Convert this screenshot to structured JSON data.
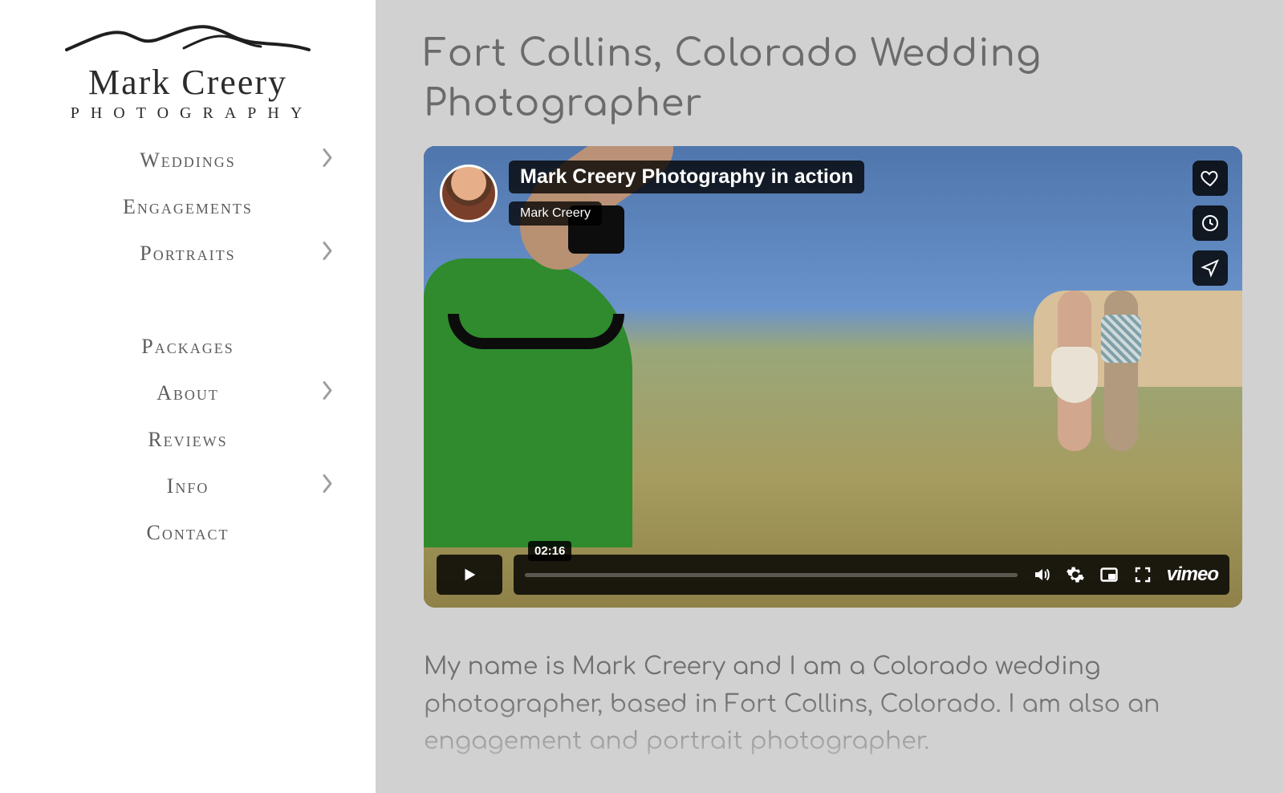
{
  "brand": {
    "line1": "Mark Creery",
    "line2": "PHOTOGRAPHY"
  },
  "nav": {
    "items": [
      {
        "label": "Weddings",
        "chevron": true
      },
      {
        "label": "Engagements",
        "chevron": false
      },
      {
        "label": "Portraits",
        "chevron": true
      }
    ],
    "items2": [
      {
        "label": "Packages",
        "chevron": false
      },
      {
        "label": "About",
        "chevron": true
      },
      {
        "label": "Reviews",
        "chevron": false
      },
      {
        "label": "Info",
        "chevron": true
      },
      {
        "label": "Contact",
        "chevron": false
      }
    ]
  },
  "page": {
    "title": "Fort Collins, Colorado Wedding Photographer"
  },
  "video": {
    "title": "Mark Creery Photography in action",
    "author": "Mark Creery",
    "duration": "02:16",
    "provider": "vimeo"
  },
  "intro": "My name is Mark Creery and I am a Colorado wedding photographer, based in Fort Collins, Colorado. I am also an engagement and portrait photographer."
}
